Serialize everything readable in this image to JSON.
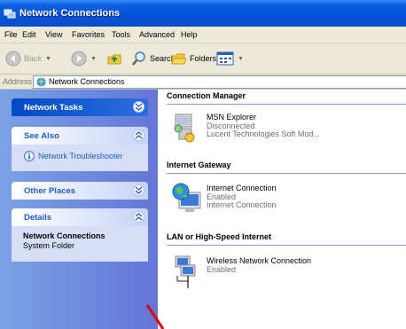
{
  "window": {
    "title": "Network Connections"
  },
  "menu": [
    "File",
    "Edit",
    "View",
    "Favorites",
    "Tools",
    "Advanced",
    "Help"
  ],
  "toolbar": {
    "back_label": "Back",
    "search_label": "Search",
    "folders_label": "Folders"
  },
  "address": {
    "label": "Address",
    "value": "Network Connections"
  },
  "sidebar": {
    "network_tasks": {
      "title": "Network Tasks"
    },
    "see_also": {
      "title": "See Also",
      "links": [
        {
          "label": "Network Troubleshooter",
          "icon": "help-info-icon"
        }
      ]
    },
    "other_places": {
      "title": "Other Places"
    },
    "details": {
      "title": "Details",
      "name": "Network Connections",
      "type": "System Folder"
    }
  },
  "main": {
    "groups": [
      {
        "header": "Connection Manager",
        "items": [
          {
            "name": "MSN Explorer",
            "status": "Disconnected",
            "device": "Lucent Technologies Soft Mod...",
            "icon": "dialup-connection-icon"
          }
        ]
      },
      {
        "header": "Internet Gateway",
        "items": [
          {
            "name": "Internet Connection",
            "status": "Enabled",
            "device": "Internet Connection",
            "icon": "internet-gateway-icon"
          }
        ]
      },
      {
        "header": "LAN or High-Speed Internet",
        "items": [
          {
            "name": "Wireless Network Connection",
            "status": "Enabled",
            "icon": "wireless-connection-icon"
          }
        ]
      }
    ]
  },
  "colors": {
    "titlebar": "#0653d8",
    "sidebar": "#6375d6",
    "link": "#215dc6",
    "annotation": "#e00000"
  }
}
